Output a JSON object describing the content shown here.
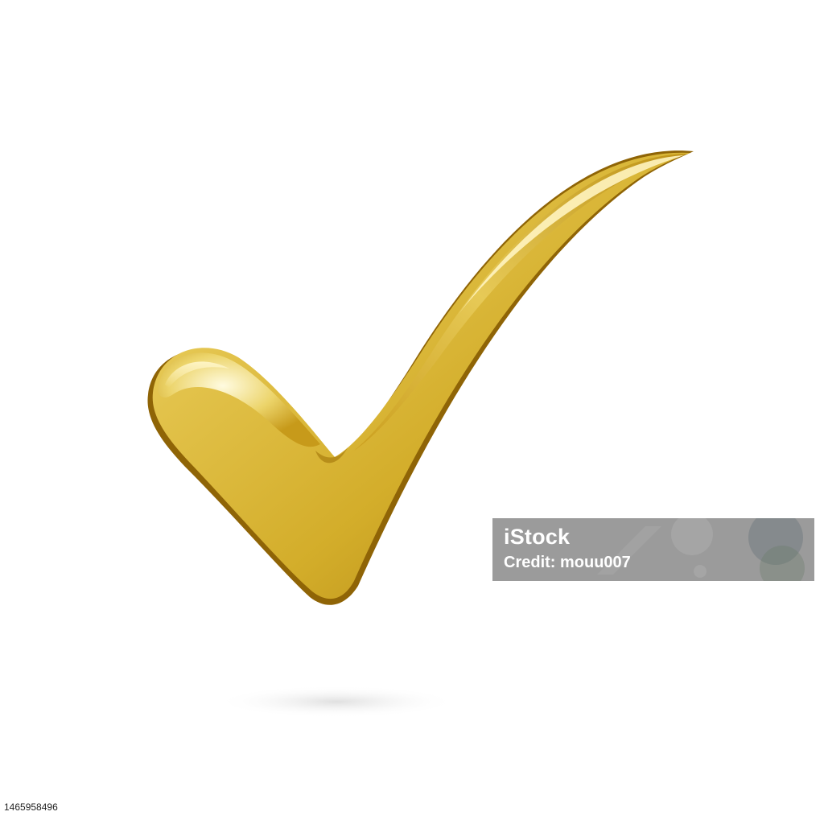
{
  "image": {
    "subject": "gold-checkmark",
    "background_color": "#ffffff",
    "accent_colors": {
      "gold_light": "#fbeb9e",
      "gold_mid": "#d9b431",
      "gold_dark": "#9c6f07",
      "shadow": "#e3e3e3"
    }
  },
  "watermark": {
    "brand": "iStock",
    "credit": "Credit: mouu007"
  },
  "stock_id": "1465958496"
}
